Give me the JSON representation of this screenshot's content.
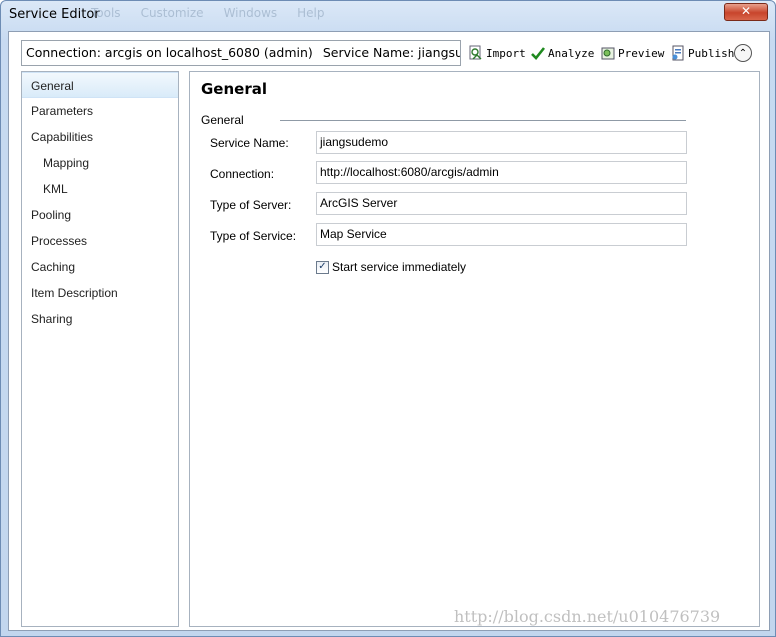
{
  "window": {
    "title": "Service Editor",
    "ghost_menu": [
      "Tools",
      "Customize",
      "Windows",
      "Help"
    ],
    "close_label": "✕"
  },
  "header": {
    "connection": "Connection: arcgis on localhost_6080 (admin)",
    "service_name": "Service Name: jiangsudemo"
  },
  "toolbar": {
    "import_label": "Import",
    "analyze_label": "Analyze",
    "preview_label": "Preview",
    "publish_label": "Publish",
    "collapse_glyph": "⌃"
  },
  "sidebar": {
    "items": [
      {
        "label": "General",
        "selected": true,
        "sub": false
      },
      {
        "label": "Parameters",
        "selected": false,
        "sub": false
      },
      {
        "label": "Capabilities",
        "selected": false,
        "sub": false
      },
      {
        "label": "Mapping",
        "selected": false,
        "sub": true
      },
      {
        "label": "KML",
        "selected": false,
        "sub": true
      },
      {
        "label": "Pooling",
        "selected": false,
        "sub": false
      },
      {
        "label": "Processes",
        "selected": false,
        "sub": false
      },
      {
        "label": "Caching",
        "selected": false,
        "sub": false
      },
      {
        "label": "Item Description",
        "selected": false,
        "sub": false
      },
      {
        "label": "Sharing",
        "selected": false,
        "sub": false
      }
    ]
  },
  "main": {
    "title": "General",
    "group_label": "General",
    "fields": {
      "service_name": {
        "label": "Service Name:",
        "value": "jiangsudemo"
      },
      "connection": {
        "label": "Connection:",
        "value": "http://localhost:6080/arcgis/admin"
      },
      "server_type": {
        "label": "Type of Server:",
        "value": "ArcGIS Server"
      },
      "service_type": {
        "label": "Type of Service:",
        "value": "Map Service"
      }
    },
    "start_service": {
      "label": "Start service immediately",
      "checked": true,
      "check_glyph": "✓"
    }
  },
  "watermark": "http://blog.csdn.net/u010476739",
  "colors": {
    "accent": "#d9ebf9",
    "window_frame": "#c7daf1",
    "close_button": "#c8452c"
  }
}
